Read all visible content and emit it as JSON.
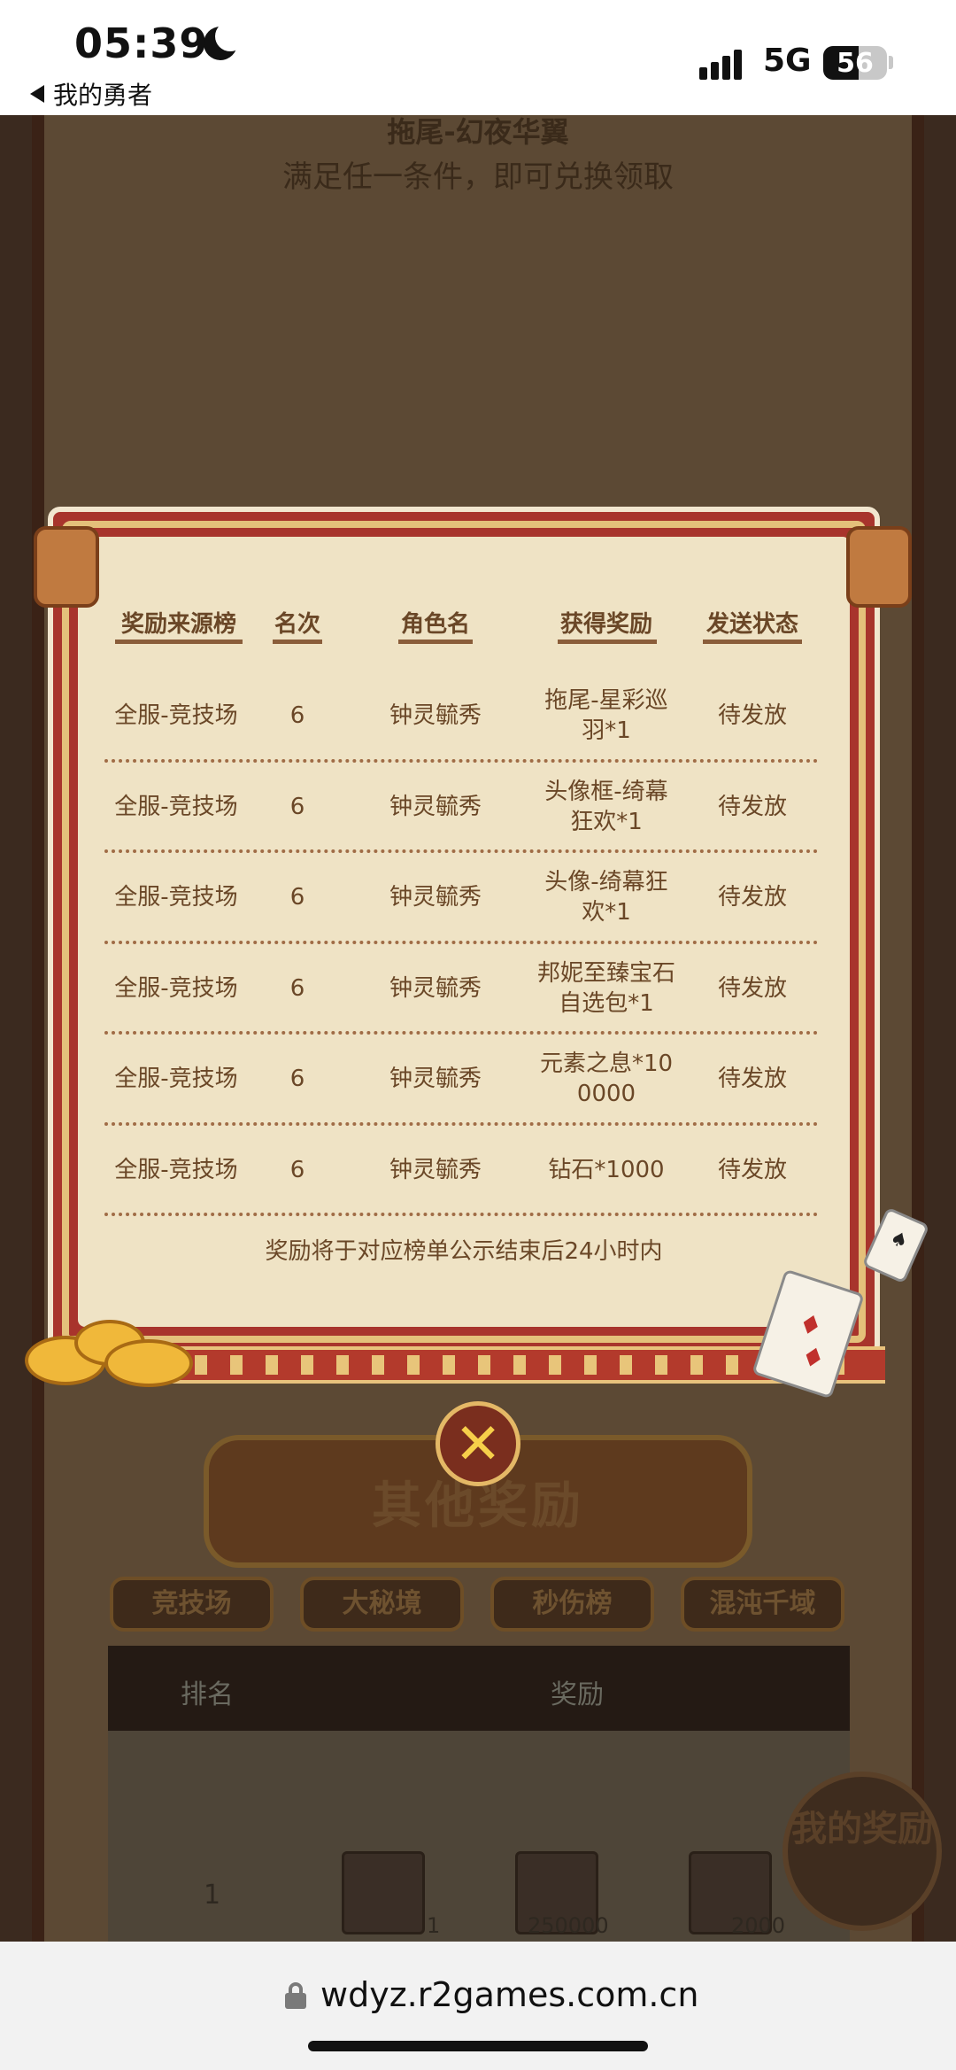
{
  "status_bar": {
    "time": "05:39",
    "back_label": "我的勇者",
    "network": "5G",
    "battery": "56",
    "battery_level": 0.56
  },
  "background": {
    "item_title": "拖尾-幻夜华翼",
    "item_subtitle": "满足任一条件，即可兑换领取",
    "banner": "其他奖励",
    "tabs": [
      "竞技场",
      "大秘境",
      "秒伤榜",
      "混沌千域"
    ],
    "table_headers": [
      "排名",
      "奖励"
    ],
    "first_row": {
      "rank": "1",
      "quantities": [
        "1",
        "250000",
        "2000"
      ]
    },
    "my_rewards_button": "我的奖励"
  },
  "popup": {
    "headers": [
      "奖励来源榜",
      "名次",
      "角色名",
      "获得奖励",
      "发送状态"
    ],
    "rows": [
      [
        "全服-竞技场",
        "6",
        "钟灵毓秀",
        "拖尾-星彩巡\n羽*1",
        "待发放"
      ],
      [
        "全服-竞技场",
        "6",
        "钟灵毓秀",
        "头像框-绮幕\n狂欢*1",
        "待发放"
      ],
      [
        "全服-竞技场",
        "6",
        "钟灵毓秀",
        "头像-绮幕狂\n欢*1",
        "待发放"
      ],
      [
        "全服-竞技场",
        "6",
        "钟灵毓秀",
        "邦妮至臻宝石\n自选包*1",
        "待发放"
      ],
      [
        "全服-竞技场",
        "6",
        "钟灵毓秀",
        "元素之息*10\n0000",
        "待发放"
      ],
      [
        "全服-竞技场",
        "6",
        "钟灵毓秀",
        "钻石*1000",
        "待发放"
      ]
    ],
    "footnote": "奖励将于对应榜单公示结束后24小时内",
    "close_icon": "close-x-icon"
  },
  "url_bar": {
    "url": "wdyz.r2games.com.cn",
    "lock_icon": "lock-icon"
  },
  "colors": {
    "panel_bg": "#efe3c5",
    "panel_text": "#6a4727",
    "frame_red": "#a8342c",
    "frame_gold": "#e4c07a"
  }
}
